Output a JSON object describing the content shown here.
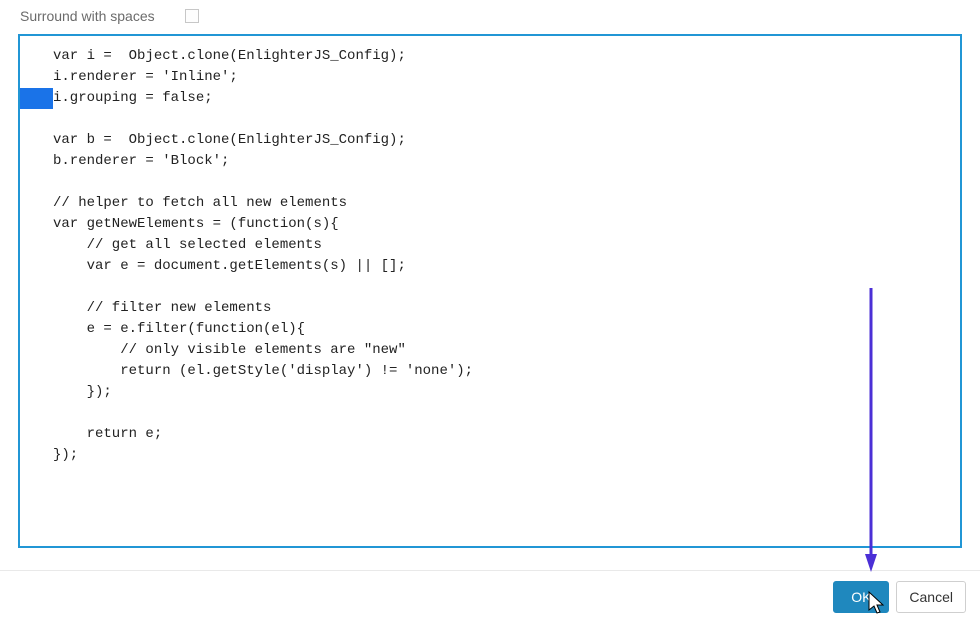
{
  "option": {
    "label": "Surround with spaces",
    "checked": false
  },
  "code": {
    "selection_line_index": 2,
    "lines": [
      "var i =  Object.clone(EnlighterJS_Config);",
      "i.renderer = 'Inline';",
      "i.grouping = false;",
      "",
      "var b =  Object.clone(EnlighterJS_Config);",
      "b.renderer = 'Block';",
      "",
      "// helper to fetch all new elements",
      "var getNewElements = (function(s){",
      "    // get all selected elements",
      "    var e = document.getElements(s) || [];",
      "",
      "    // filter new elements",
      "    e = e.filter(function(el){",
      "        // only visible elements are \"new\"",
      "        return (el.getStyle('display') != 'none');",
      "    });",
      "",
      "    return e;",
      "});"
    ]
  },
  "buttons": {
    "ok": "OK",
    "cancel": "Cancel"
  },
  "annotation": {
    "arrow_color": "#4b2fd6"
  }
}
